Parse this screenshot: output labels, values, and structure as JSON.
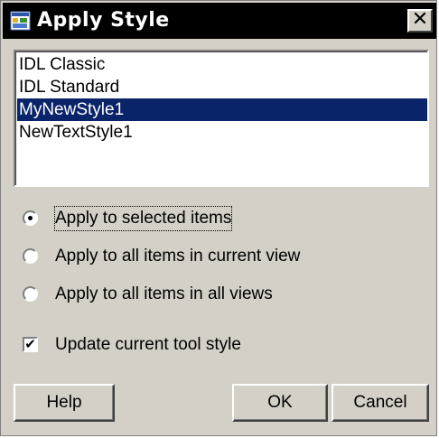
{
  "window": {
    "title": "Apply Style",
    "close_glyph": "✕",
    "title_icon": "app-icon"
  },
  "style_list": {
    "items": [
      "IDL Classic",
      "IDL Standard",
      "MyNewStyle1",
      "NewTextStyle1"
    ],
    "selected_index": 2
  },
  "apply_options": {
    "options": [
      {
        "label": "Apply to selected items",
        "checked": true
      },
      {
        "label": "Apply to all items in current view",
        "checked": false
      },
      {
        "label": "Apply to all items in all views",
        "checked": false
      }
    ]
  },
  "update_tool_style": {
    "label": "Update current tool style",
    "checked": true,
    "check_glyph": "✔"
  },
  "buttons": {
    "help_label": "Help",
    "ok_label": "OK",
    "cancel_label": "Cancel"
  },
  "colors": {
    "titlebar_bg": "#000000",
    "dialog_bg": "#d4d0c8",
    "selection_bg": "#0a246a"
  }
}
